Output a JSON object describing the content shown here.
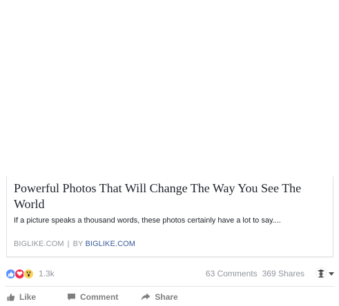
{
  "link": {
    "title": "Powerful Photos That Will Change The Way You See The World",
    "description": "If a picture speaks a thousand words, these photos certainly have a lot to say....",
    "source": "BIGLIKE.COM",
    "separator": "|",
    "by_label": "BY",
    "author": "BIGLIKE.COM"
  },
  "stats": {
    "reaction_icons": [
      "like-icon",
      "love-icon",
      "wow-icon"
    ],
    "reaction_count": "1.3k",
    "comments": "63 Comments",
    "shares": "369 Shares"
  },
  "actions": {
    "like": "Like",
    "comment": "Comment",
    "share": "Share"
  },
  "colors": {
    "link_blue": "#365899",
    "muted_gray": "#90949c",
    "action_gray": "#7f7f7f",
    "like_blue": "#5890ff",
    "love_red": "#f0284a",
    "wow_yellow": "#fcd25a"
  }
}
